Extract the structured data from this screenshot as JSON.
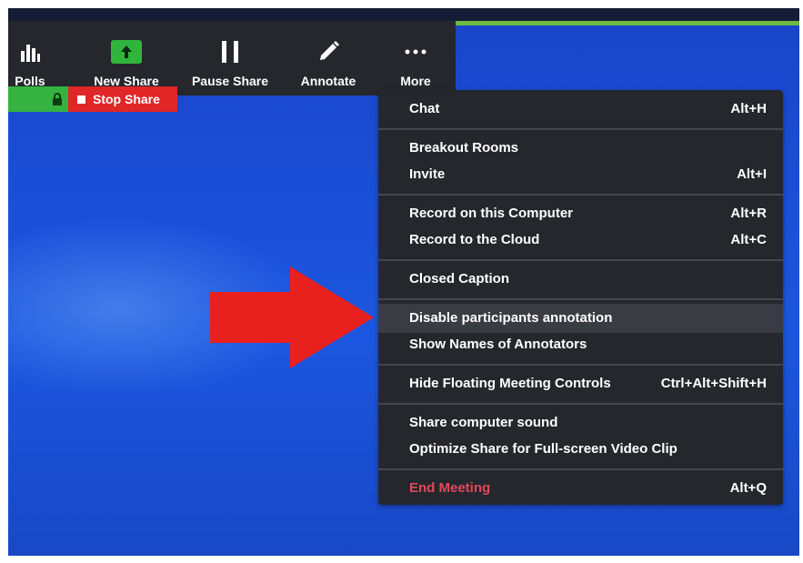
{
  "toolbar": {
    "polls_label": "Polls",
    "new_share_label": "New Share",
    "pause_share_label": "Pause Share",
    "annotate_label": "Annotate",
    "more_label": "More",
    "icons": {
      "polls": "bar-chart-icon",
      "new_share": "upload-arrow-icon",
      "pause_share": "pause-icon",
      "annotate": "pencil-icon",
      "more": "ellipsis-icon"
    }
  },
  "share_status": {
    "lock_icon": "lock-icon",
    "stop_share_label": "Stop Share"
  },
  "menu": {
    "items": [
      {
        "label": "Chat",
        "shortcut": "Alt+H"
      },
      {
        "label": "Breakout Rooms",
        "shortcut": ""
      },
      {
        "label": "Invite",
        "shortcut": "Alt+I"
      },
      {
        "label": "Record on this Computer",
        "shortcut": "Alt+R"
      },
      {
        "label": "Record to the Cloud",
        "shortcut": "Alt+C"
      },
      {
        "label": "Closed Caption",
        "shortcut": ""
      },
      {
        "label": "Disable participants annotation",
        "shortcut": ""
      },
      {
        "label": "Show Names of Annotators",
        "shortcut": ""
      },
      {
        "label": "Hide Floating Meeting Controls",
        "shortcut": "Ctrl+Alt+Shift+H"
      },
      {
        "label": "Share computer sound",
        "shortcut": ""
      },
      {
        "label": "Optimize Share for Full-screen Video Clip",
        "shortcut": ""
      },
      {
        "label": "End Meeting",
        "shortcut": "Alt+Q"
      }
    ],
    "highlighted_item": "Disable participants annotation"
  },
  "colors": {
    "toolbar_bg": "#25272d",
    "menu_bg": "#25272d",
    "stop_share_red": "#e02626",
    "lock_green": "#36b240",
    "new_share_green": "#2fb53c",
    "end_meeting_red": "#e0495a",
    "arrow_red": "#e8211f",
    "desktop_blue": "#1b4fd8"
  }
}
